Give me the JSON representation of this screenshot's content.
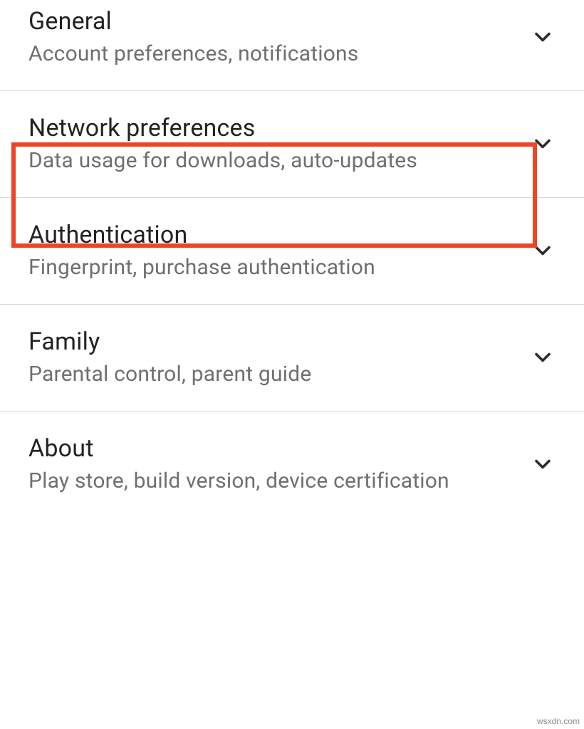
{
  "settings": {
    "items": [
      {
        "title": "General",
        "subtitle": "Account preferences, notifications"
      },
      {
        "title": "Network preferences",
        "subtitle": "Data usage for downloads, auto-updates"
      },
      {
        "title": "Authentication",
        "subtitle": "Fingerprint, purchase authentication"
      },
      {
        "title": "Family",
        "subtitle": "Parental control, parent guide"
      },
      {
        "title": "About",
        "subtitle": "Play store, build version, device certification"
      }
    ]
  },
  "watermark": "wsxdn.com",
  "colors": {
    "highlight": "#ef4423",
    "divider": "#d9d9d9",
    "title": "#222222",
    "subtitle": "#6f6f6f"
  }
}
